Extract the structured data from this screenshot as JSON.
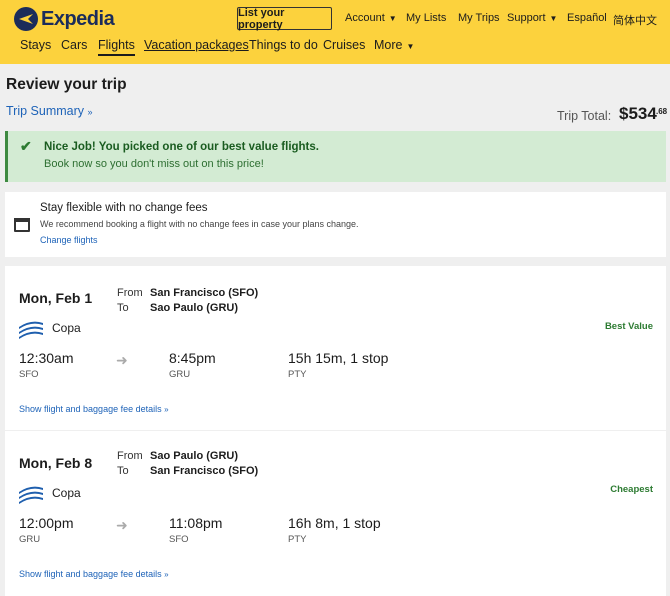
{
  "brand": {
    "name": "Expedia"
  },
  "header": {
    "list_property": "List your property",
    "account": "Account",
    "my_lists": "My Lists",
    "my_trips": "My Trips",
    "support": "Support",
    "espanol": "Español",
    "chinese": "简体中文"
  },
  "nav": {
    "stays": "Stays",
    "cars": "Cars",
    "flights": "Flights",
    "vacation": "Vacation packages",
    "things": "Things to do",
    "cruises": "Cruises",
    "more": "More"
  },
  "page": {
    "title": "Review your trip",
    "trip_summary": "Trip Summary",
    "trip_total_label": "Trip Total:",
    "trip_total_amount": "$534",
    "trip_total_cents": ".68"
  },
  "alert": {
    "title": "Nice Job! You picked one of our best value flights.",
    "subtitle": "Book now so you don't miss out on this price!"
  },
  "flex": {
    "title": "Stay flexible with no change fees",
    "subtitle": "We recommend booking a flight with no change fees in case your plans change.",
    "link": "Change flights"
  },
  "flights": [
    {
      "date": "Mon, Feb 1",
      "from_label": "From",
      "to_label": "To",
      "from": "San Francisco (SFO)",
      "to": "Sao Paulo (GRU)",
      "airline": "Copa",
      "badge": "Best Value",
      "dep_time": "12:30am",
      "dep_code": "SFO",
      "arr_time": "8:45pm",
      "arr_code": "GRU",
      "duration": "15h 15m, 1 stop",
      "stop_code": "PTY",
      "details_link": "Show flight and baggage fee details"
    },
    {
      "date": "Mon, Feb 8",
      "from_label": "From",
      "to_label": "To",
      "from": "Sao Paulo (GRU)",
      "to": "San Francisco (SFO)",
      "airline": "Copa",
      "badge": "Cheapest",
      "dep_time": "12:00pm",
      "dep_code": "GRU",
      "arr_time": "11:08pm",
      "arr_code": "SFO",
      "duration": "16h 8m, 1 stop",
      "stop_code": "PTY",
      "details_link": "Show flight and baggage fee details"
    }
  ],
  "colors": {
    "header_bg": "#fcd23d",
    "link": "#1e63b8",
    "success": "#2d7b32"
  }
}
